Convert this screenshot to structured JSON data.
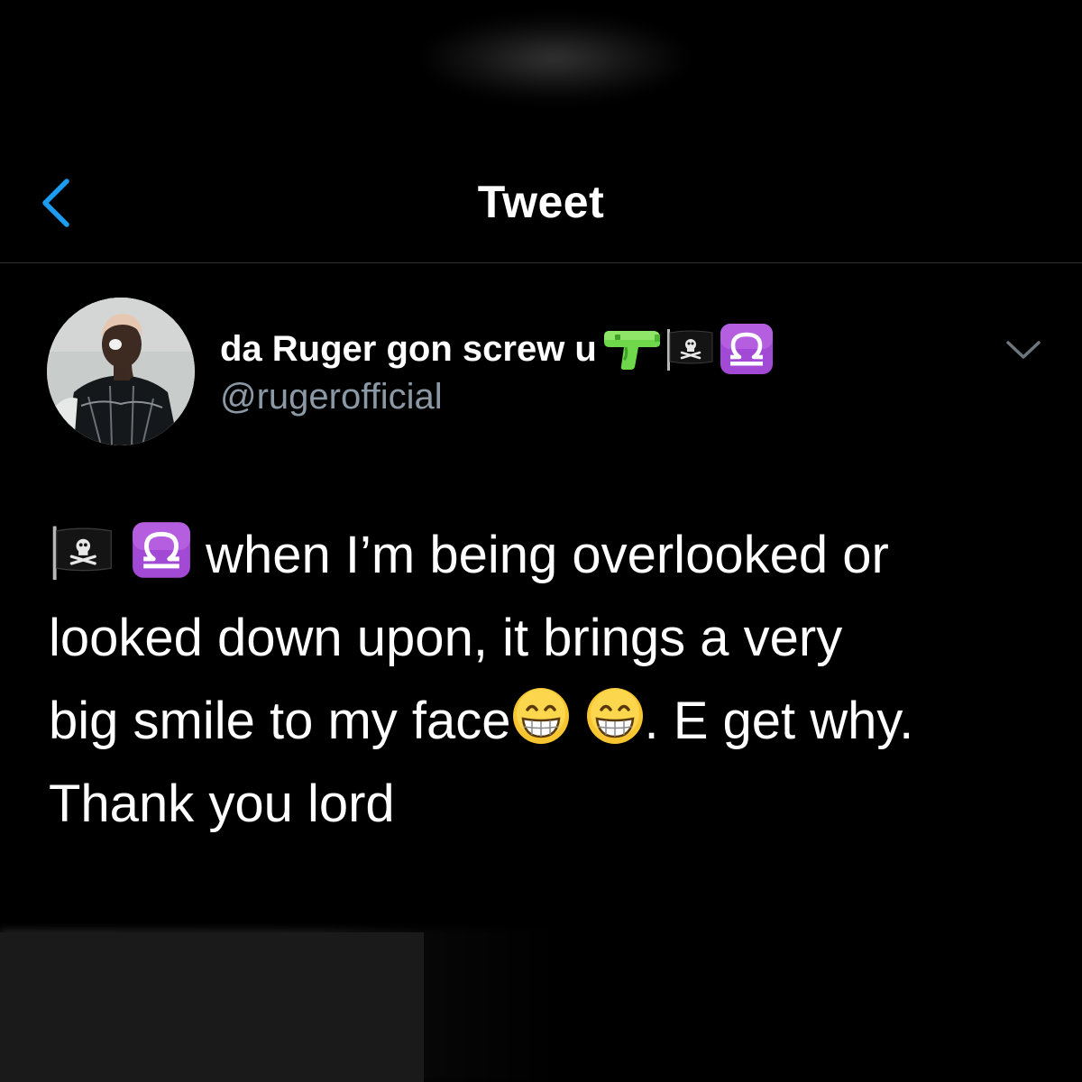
{
  "header": {
    "title": "Tweet",
    "back_icon": "chevron-left-icon"
  },
  "colors": {
    "background": "#000000",
    "accent": "#1d9bf0",
    "secondary_text": "#8b98a5",
    "divider": "#2f3336"
  },
  "author": {
    "display_name": "da Ruger gon screw u",
    "display_name_emojis": [
      "water-pistol-icon",
      "pirate-flag-icon",
      "libra-icon"
    ],
    "handle": "@rugerofficial",
    "avatar": "avatar",
    "menu_icon": "chevron-down-icon"
  },
  "tweet": {
    "line1_text": "when I’m being overlooked or",
    "line1_emojis": [
      "pirate-flag-icon",
      "libra-icon"
    ],
    "line2_text": "looked down upon, it brings a very",
    "line3_text_a": "big smile to my face",
    "line3_emojis": [
      "grinning-face-icon",
      "grinning-face-icon"
    ],
    "line3_text_b": ". E get why.",
    "line4_text": "Thank you lord"
  }
}
